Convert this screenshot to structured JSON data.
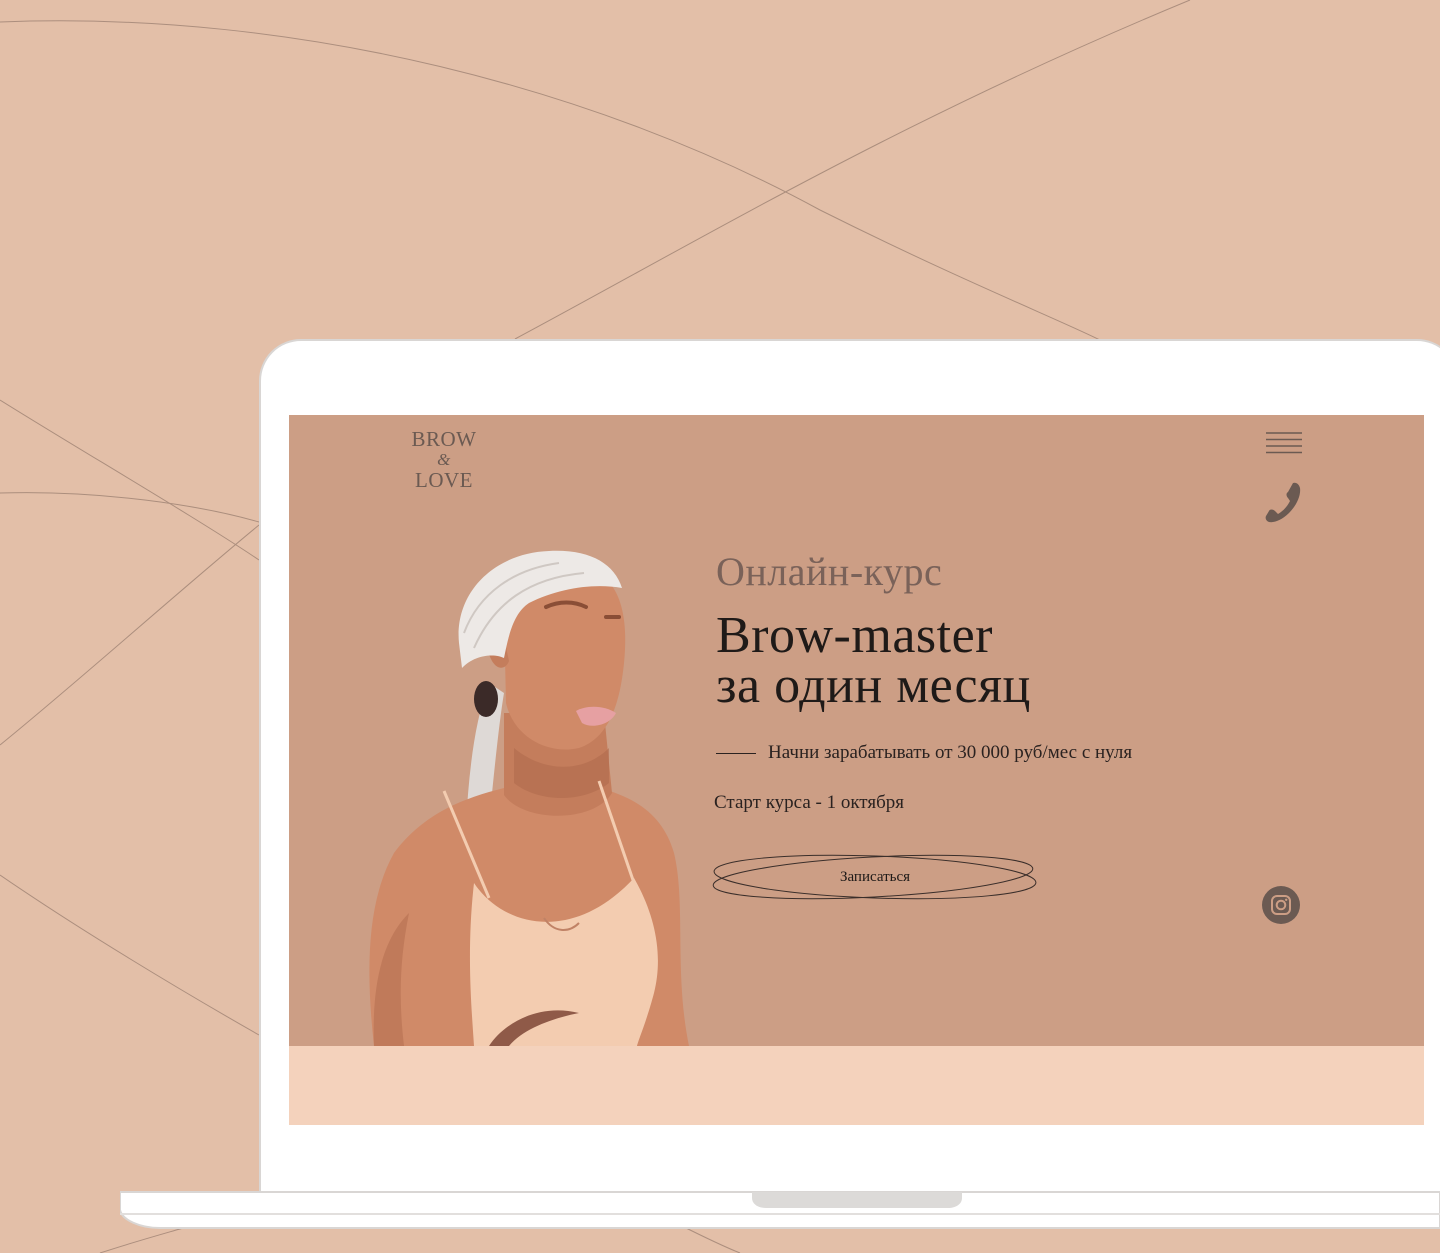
{
  "logo": {
    "line1": "BROW",
    "amp": "&",
    "line2": "LOVE"
  },
  "icons": {
    "menu": "hamburger-menu-icon",
    "phone": "phone-icon",
    "social": "instagram-icon"
  },
  "hero": {
    "kicker": "Онлайн-курс",
    "title_line1": "Brow-master",
    "title_line2": "за один месяц",
    "tagline": "Начни зарабатывать от 30 000 руб/мес с нуля",
    "start_date": "Старт курса - 1 октября",
    "cta_label": "Записаться"
  },
  "colors": {
    "page_background": "#e3bfa8",
    "hero_background": "#cc9e85",
    "section_below": "#f4d2bc",
    "text_dark": "#1f1a18",
    "text_muted": "#7a6259",
    "icon_color": "#6b5a52"
  }
}
